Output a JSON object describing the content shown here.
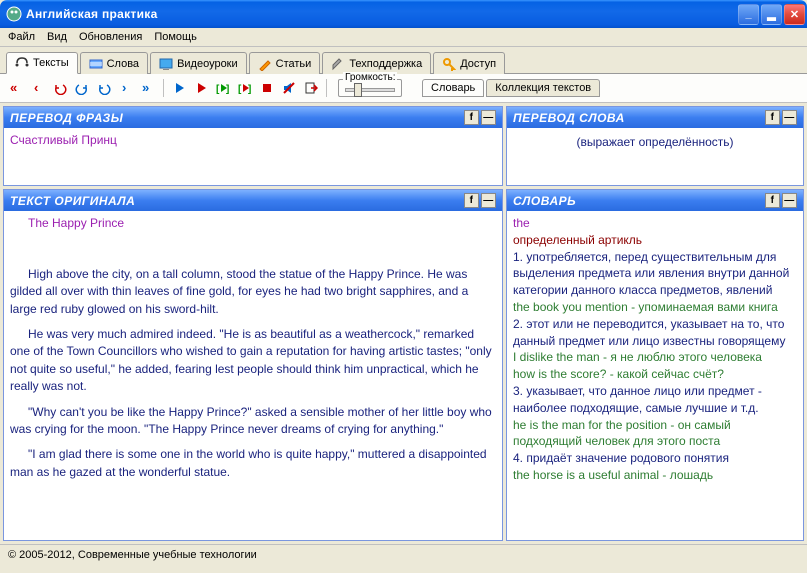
{
  "title": "Английская практика",
  "menu": {
    "file": "Файл",
    "view": "Вид",
    "updates": "Обновления",
    "help": "Помощь"
  },
  "tabs": {
    "texts": "Тексты",
    "words": "Слова",
    "video": "Видеоуроки",
    "articles": "Статьи",
    "support": "Техподдержка",
    "access": "Доступ"
  },
  "volume_label": "Громкость:",
  "right_tabs": {
    "dict": "Словарь",
    "coll": "Коллекция текстов"
  },
  "panels": {
    "phrase_title": "ПЕРЕВОД ФРАЗЫ",
    "text_title": "ТЕКСТ ОРИГИНАЛА",
    "word_title": "ПЕРЕВОД СЛОВА",
    "dict_title": "СЛОВАРЬ",
    "btn_f": "f",
    "btn_min": "—"
  },
  "phrase_body": "Счастливый Принц",
  "word_body": "(выражает определённость)",
  "text": {
    "title": "The Happy Prince",
    "p1": "High above the city, on a tall column, stood the statue of the Happy Prince. He was gilded all over with thin leaves of fine gold, for eyes he had two bright sapphires, and a large red ruby glowed on his sword-hilt.",
    "p2": "He was very much admired indeed. \"He is as beautiful as a weathercock,\" remarked one of the Town Councillors who wished to gain a reputation for having artistic tastes; \"only not quite so useful,\" he added, fearing lest people should think him unpractical, which he really was not.",
    "p3": "\"Why can't you be like the Happy Prince?\" asked a sensible mother of her little boy who was crying for the moon. \"The Happy Prince never dreams of crying for anything.\"",
    "p4": "\"I am glad there is some one in the world who is quite happy,\" muttered a disappointed man as he gazed at the wonderful statue."
  },
  "dict": {
    "word": "the",
    "def": "определенный артикль",
    "n1": "1. употребляется, перед существительным для выделения предмета или явления внутри данной категории данного класса предметов, явлений",
    "ex1": "the book you mention - упоминаемая вами книга",
    "n2": "2. этот или не переводится, указывает на то, что данный предмет или лицо известны говорящему",
    "ex2a": "I dislike the man - я не люблю этого человека",
    "ex2b": "how is the score? - какой сейчас счёт?",
    "n3": "3. указывает, что данное лицо или предмет - наиболее подходящие, самые лучшие и т.д.",
    "ex3": "he is the man for the position - он самый подходящий человек для этого поста",
    "n4": "4. придаёт значение родового понятия",
    "ex4": "the horse is a useful animal - лошадь"
  },
  "status": "© 2005-2012, Современные учебные технологии"
}
